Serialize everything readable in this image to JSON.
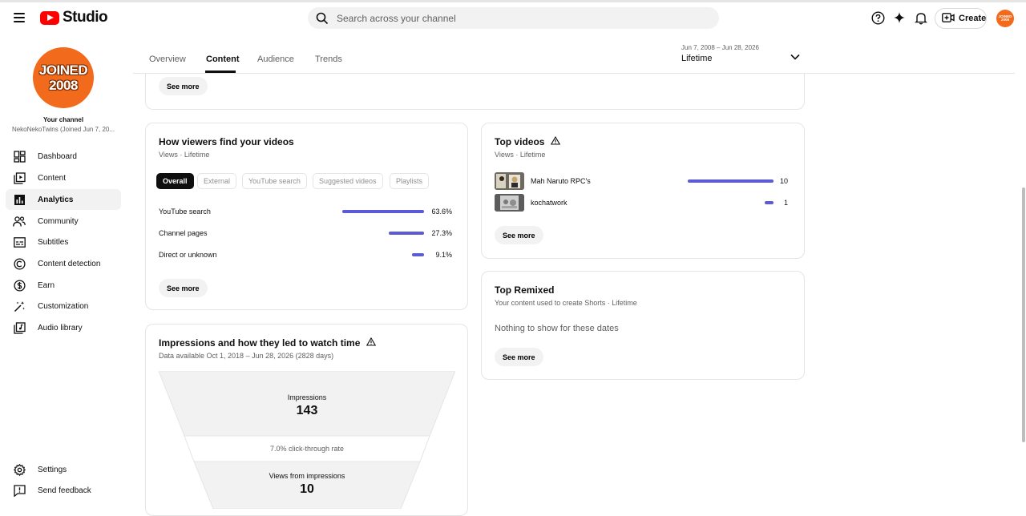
{
  "header": {
    "logo_text": "Studio",
    "search_placeholder": "Search across your channel",
    "create_label": "Create",
    "avatar_text": "JOINED 2008"
  },
  "sidebar": {
    "avatar_line1": "JOINED",
    "avatar_line2": "2008",
    "your_channel": "Your channel",
    "channel_name": "NekoNekoTwins (Joined Jun 7, 20...",
    "items": [
      {
        "label": "Dashboard",
        "icon": "dashboard-icon"
      },
      {
        "label": "Content",
        "icon": "content-icon"
      },
      {
        "label": "Analytics",
        "icon": "analytics-icon",
        "active": true
      },
      {
        "label": "Community",
        "icon": "community-icon"
      },
      {
        "label": "Subtitles",
        "icon": "subtitles-icon"
      },
      {
        "label": "Content detection",
        "icon": "content-detection-icon"
      },
      {
        "label": "Earn",
        "icon": "earn-icon"
      },
      {
        "label": "Customization",
        "icon": "customization-icon"
      },
      {
        "label": "Audio library",
        "icon": "audio-library-icon"
      }
    ],
    "bottom": [
      {
        "label": "Settings",
        "icon": "settings-icon"
      },
      {
        "label": "Send feedback",
        "icon": "feedback-icon"
      }
    ]
  },
  "tabs": {
    "items": [
      "Overview",
      "Content",
      "Audience",
      "Trends"
    ],
    "active": "Content",
    "date_range": "Jun 7, 2008 – Jun 28, 2026",
    "date_label": "Lifetime"
  },
  "top_card": {
    "see_more": "See more"
  },
  "traffic": {
    "title": "How viewers find your videos",
    "subtitle": "Views · Lifetime",
    "chips": [
      "Overall",
      "External",
      "YouTube search",
      "Suggested videos",
      "Playlists"
    ],
    "rows": [
      {
        "label": "YouTube search",
        "value": "63.6%",
        "fraction": 0.636
      },
      {
        "label": "Channel pages",
        "value": "27.3%",
        "fraction": 0.273
      },
      {
        "label": "Direct or unknown",
        "value": "9.1%",
        "fraction": 0.091
      }
    ],
    "see_more": "See more"
  },
  "impressions": {
    "title": "Impressions and how they led to watch time",
    "subtitle": "Data available Oct 1, 2018 – Jun 28, 2026 (2828 days)",
    "impressions_label": "Impressions",
    "impressions_value": "143",
    "ctr": "7.0% click-through rate",
    "views_label": "Views from impressions",
    "views_value": "10"
  },
  "top_videos": {
    "title": "Top videos",
    "subtitle": "Views · Lifetime",
    "videos": [
      {
        "title": "Mah Naruto RPC's",
        "value": "10",
        "fraction": 1.0
      },
      {
        "title": "kochatwork",
        "value": "1",
        "fraction": 0.1
      }
    ],
    "see_more": "See more"
  },
  "top_remixed": {
    "title": "Top Remixed",
    "subtitle": "Your content used to create Shorts · Lifetime",
    "empty": "Nothing to show for these dates",
    "see_more": "See more"
  },
  "colors": {
    "accent": "#5b5bd6",
    "brand": "#ff0000",
    "avatar": "#f26a1b"
  }
}
